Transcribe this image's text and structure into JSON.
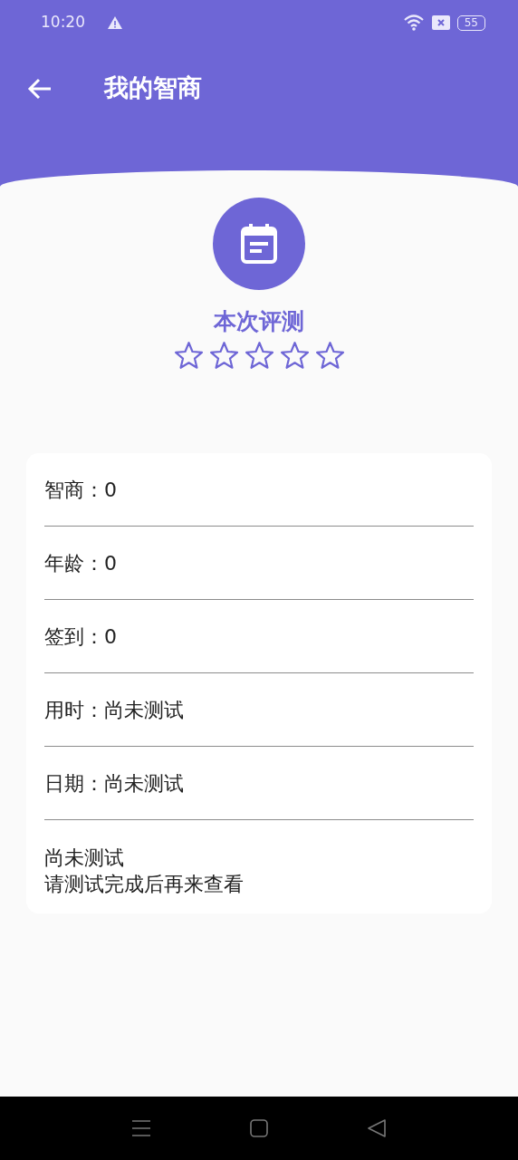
{
  "status_bar": {
    "time": "10:20",
    "battery": "55"
  },
  "app_bar": {
    "title": "我的智商"
  },
  "result": {
    "title": "本次评测",
    "stars": 0
  },
  "details": [
    {
      "text": "智商：0"
    },
    {
      "text": "年龄：0"
    },
    {
      "text": "签到：0"
    },
    {
      "text": "用时：尚未测试"
    },
    {
      "text": "日期：尚未测试"
    }
  ],
  "message": [
    "尚未测试",
    "请测试完成后再来查看"
  ]
}
